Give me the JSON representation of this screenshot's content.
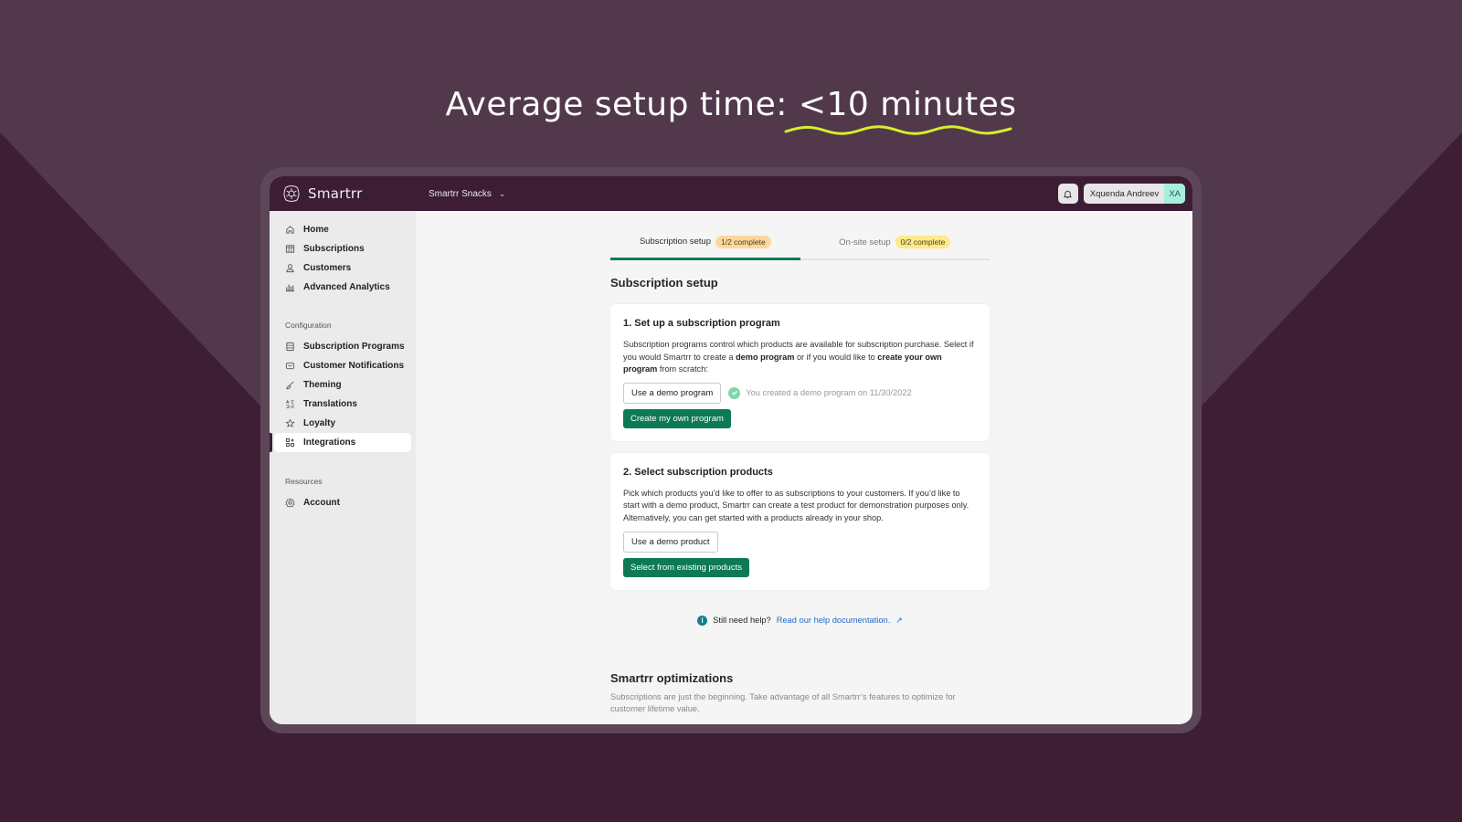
{
  "headline": {
    "prefix": "Average setup time: ",
    "highlight": "<10 minutes",
    "accent_color": "#d4ef2a"
  },
  "app": {
    "brand": "Smartrr",
    "store_name": "Smartrr Snacks",
    "user": {
      "name": "Xquenda Andreev",
      "initials": "XA"
    }
  },
  "sidebar": {
    "primary": [
      {
        "label": "Home",
        "icon": "home-icon"
      },
      {
        "label": "Subscriptions",
        "icon": "grid-icon"
      },
      {
        "label": "Customers",
        "icon": "person-icon"
      },
      {
        "label": "Advanced Analytics",
        "icon": "bar-chart-icon"
      }
    ],
    "config_label": "Configuration",
    "config": [
      {
        "label": "Subscription Programs",
        "icon": "list-icon"
      },
      {
        "label": "Customer Notifications",
        "icon": "mail-icon"
      },
      {
        "label": "Theming",
        "icon": "brush-icon"
      },
      {
        "label": "Translations",
        "icon": "translate-icon"
      },
      {
        "label": "Loyalty",
        "icon": "star-icon"
      },
      {
        "label": "Integrations",
        "icon": "apps-icon",
        "active": true
      }
    ],
    "resources_label": "Resources",
    "resources": [
      {
        "label": "Account",
        "icon": "gear-icon"
      }
    ]
  },
  "tabs": [
    {
      "label": "Subscription setup",
      "badge": "1/2 complete",
      "active": true
    },
    {
      "label": "On-site setup",
      "badge": "0/2 complete",
      "active": false
    }
  ],
  "page_title": "Subscription setup",
  "step1": {
    "title": "1. Set up a subscription program",
    "desc_1": "Subscription programs control which products are available for subscription purchase. Select if you would Smartrr to create a ",
    "desc_bold_1": "demo program",
    "desc_2": " or if you would like to ",
    "desc_bold_2": "create your own program",
    "desc_3": " from scratch:",
    "demo_button": "Use a demo program",
    "done_note": "You created a demo program on 11/30/2022",
    "primary_button": "Create my own program"
  },
  "step2": {
    "title": "2. Select subscription products",
    "desc": "Pick which products you’d like to offer to as subscriptions to your customers. If you’d like to start with a demo product, Smartrr can create a test product for demonstration purposes only. Alternatively, you can get started with a products already in your shop.",
    "demo_button": "Use a demo product",
    "primary_button": "Select from existing products"
  },
  "help": {
    "text": "Still need help?",
    "link": "Read our help documentation."
  },
  "optimizations": {
    "title": "Smartrr optimizations",
    "desc": "Subscriptions are just the beginning. Take advantage of all Smartrr’s features to optimize for customer lifetime value."
  }
}
